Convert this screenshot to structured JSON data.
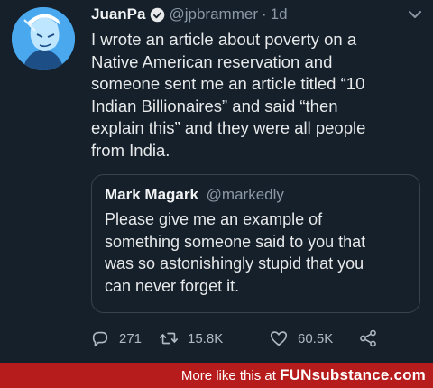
{
  "tweet": {
    "display_name": "JuanPa",
    "handle": "@jpbrammer",
    "separator": "·",
    "time": "1d",
    "text": "I wrote an article about poverty on a\nNative American reservation and\nsomeone sent me an article titled “10\nIndian Billionaires” and said “then\nexplain this” and they were all people\nfrom India.",
    "avatar_icon": "avatar-portrait",
    "verified_icon": "verified-badge-icon",
    "more_icon": "chevron-down-icon"
  },
  "quote": {
    "display_name": "Mark Magark",
    "handle": "@markedly",
    "text": "Please give me an example of\nsomething someone said to you that\nwas so astonishingly stupid that you\ncan never forget it."
  },
  "actions": {
    "reply_count": "271",
    "retweet_count": "15.8K",
    "like_count": "60.5K",
    "reply_icon": "reply-icon",
    "retweet_icon": "retweet-icon",
    "like_icon": "heart-icon",
    "share_icon": "share-icon"
  },
  "footer": {
    "text": "More like this at",
    "brand": "FUNsubstance.com"
  },
  "colors": {
    "background": "#15202b",
    "text": "#e7e9ea",
    "muted": "#8b98a5",
    "border": "#38444d",
    "footer_bar": "#b71c1c"
  }
}
